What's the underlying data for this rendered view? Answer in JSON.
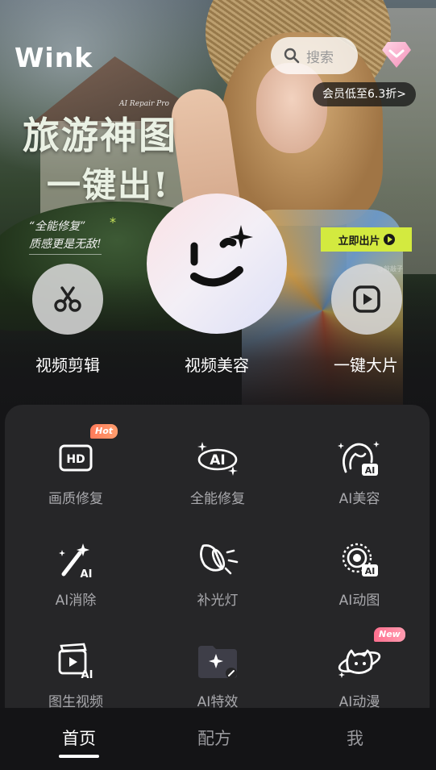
{
  "header": {
    "logo": "Wink",
    "search_placeholder": "搜索",
    "vip_promo": "会员低至6.3折>"
  },
  "banner": {
    "subtitle": "AI Repair Pro",
    "title_line1": "旅游神图",
    "title_line2": "一键出!",
    "tagline1": "“全能修复”",
    "tagline2": "质感更是无敌!",
    "cta": "立即出片",
    "watermark": "@敲敲子"
  },
  "main_actions": [
    {
      "label": "视频剪辑",
      "icon": "scissors-icon"
    },
    {
      "label": "视频美容",
      "icon": "wink-face-icon"
    },
    {
      "label": "一键大片",
      "icon": "play-square-icon"
    }
  ],
  "tools": [
    {
      "label": "画质修复",
      "icon": "hd-icon",
      "badge": "Hot"
    },
    {
      "label": "全能修复",
      "icon": "ai-sparkle-icon"
    },
    {
      "label": "AI美容",
      "icon": "ai-face-icon"
    },
    {
      "label": "AI消除",
      "icon": "magic-wand-icon"
    },
    {
      "label": "补光灯",
      "icon": "fill-light-icon"
    },
    {
      "label": "AI动图",
      "icon": "ai-animate-icon"
    },
    {
      "label": "图生视频",
      "icon": "image-to-video-icon"
    },
    {
      "label": "AI特效",
      "icon": "ai-effects-icon"
    },
    {
      "label": "AI动漫",
      "icon": "ai-anime-icon",
      "badge": "New"
    }
  ],
  "tabbar": {
    "home": "首页",
    "recipe": "配方",
    "me": "我"
  },
  "colors": {
    "accent": "#d3ea3f",
    "background": "#151517",
    "panel": "#262628",
    "hot_badge": "#ff8a64",
    "new_badge": "#ff8aa2"
  }
}
